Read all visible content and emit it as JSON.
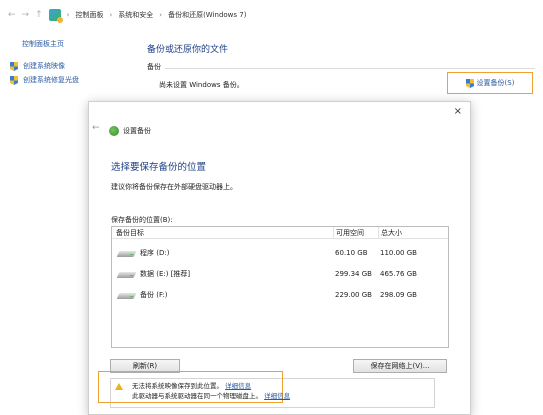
{
  "address_bar": {
    "back": "←",
    "forward": "→",
    "up": "↑",
    "crumbs": [
      "控制面板",
      "系统和安全",
      "备份和还原(Windows 7)"
    ],
    "separator": "›"
  },
  "sidebar": {
    "home": "控制面板主页",
    "items": [
      {
        "label": "创建系统映像",
        "icon": "shield-icon"
      },
      {
        "label": "创建系统修复光盘",
        "icon": "shield-icon"
      }
    ]
  },
  "main": {
    "title": "备份或还原你的文件",
    "group_label": "备份",
    "status": "尚未设置 Windows 备份。",
    "setup_link": "设置备份(S)"
  },
  "dialog": {
    "close": "×",
    "back": "←",
    "header": "设置备份",
    "title": "选择要保存备份的位置",
    "subtitle": "建议你将备份保存在外部硬盘驱动器上。",
    "location_label": "保存备份的位置(B):",
    "columns": [
      "备份目标",
      "可用空间",
      "总大小"
    ],
    "rows": [
      {
        "name": "程序 (D:)",
        "free": "60.10 GB",
        "total": "110.00 GB"
      },
      {
        "name": "数据 (E:) [推荐]",
        "free": "299.34 GB",
        "total": "465.76 GB"
      },
      {
        "name": "备份 (F:)",
        "free": "229.00 GB",
        "total": "298.09 GB"
      }
    ],
    "refresh_button": "刷新(R)",
    "network_button": "保存在网络上(V)...",
    "warning_line1": "无法将系统映像保存到此位置。",
    "warning_link1": "详细信息",
    "warning_line2": "此驱动器与系统驱动器在同一个物理磁盘上。",
    "warning_link2": "详细信息"
  },
  "colors": {
    "link": "#2b5aa0",
    "title": "#1e3f86",
    "highlight": "#f0a030"
  }
}
